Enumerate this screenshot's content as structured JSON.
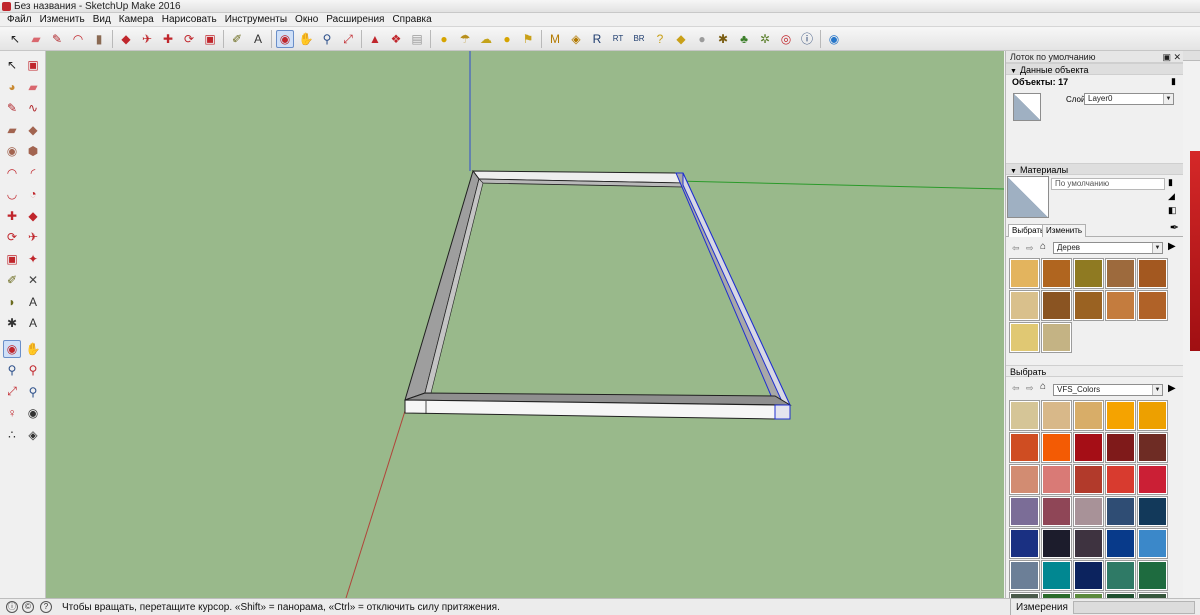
{
  "window": {
    "title": "Без названия - SketchUp Make 2016"
  },
  "menu": [
    "Файл",
    "Изменить",
    "Вид",
    "Камера",
    "Нарисовать",
    "Инструменты",
    "Окно",
    "Расширения",
    "Справка"
  ],
  "toolbar": {
    "tools": [
      {
        "name": "select-tool",
        "icon": "arrow-icon",
        "glyph": "↖",
        "color": "#222222",
        "active": false
      },
      {
        "name": "eraser-tool",
        "icon": "eraser-icon",
        "glyph": "▰",
        "color": "#d9676e",
        "active": false
      },
      {
        "name": "line-tool",
        "icon": "pencil-icon",
        "glyph": "✎",
        "color": "#b0272c",
        "active": false
      },
      {
        "name": "arc-tool",
        "icon": "arc-icon",
        "glyph": "◠",
        "color": "#c0262c",
        "active": false
      },
      {
        "name": "shape-tool",
        "icon": "rectangle-icon",
        "glyph": "▮",
        "color": "#8a6a53",
        "active": false
      },
      {
        "name": "push-pull-tool",
        "icon": "push-pull-icon",
        "glyph": "◆",
        "color": "#c0262c",
        "active": false
      },
      {
        "name": "follow-me-tool",
        "icon": "follow-me-icon",
        "glyph": "✈",
        "color": "#c0262c",
        "active": false
      },
      {
        "name": "move-tool",
        "icon": "move-icon",
        "glyph": "✚",
        "color": "#c0262c",
        "active": false
      },
      {
        "name": "rotate-tool",
        "icon": "rotate-icon",
        "glyph": "⟳",
        "color": "#c0262c",
        "active": false
      },
      {
        "name": "scale-tool",
        "icon": "scale-icon",
        "glyph": "▣",
        "color": "#c0262c",
        "active": false
      },
      {
        "name": "tape-measure-tool",
        "icon": "tape-measure-icon",
        "glyph": "✐",
        "color": "#6b6b1e",
        "active": false
      },
      {
        "name": "text-tool",
        "icon": "text-icon",
        "glyph": "A",
        "color": "#333333",
        "active": false
      },
      {
        "name": "orbit-tool",
        "icon": "orbit-icon",
        "glyph": "◉",
        "color": "#c0262c",
        "active": true
      },
      {
        "name": "pan-tool",
        "icon": "hand-icon",
        "glyph": "✋",
        "color": "#c98a32",
        "active": false
      },
      {
        "name": "zoom-tool",
        "icon": "magnifier-icon",
        "glyph": "⚲",
        "color": "#2c4f8a",
        "active": false
      },
      {
        "name": "zoom-extents-tool",
        "icon": "zoom-extents-icon",
        "glyph": "⤢",
        "color": "#c0262c",
        "active": false
      },
      {
        "name": "warehouse-button",
        "icon": "warehouse-icon",
        "glyph": "▲",
        "color": "#c0262c",
        "active": false
      },
      {
        "name": "components-button",
        "icon": "components-icon",
        "glyph": "❖",
        "color": "#c0262c",
        "active": false
      },
      {
        "name": "extensions-button",
        "icon": "extension-icon",
        "glyph": "▤",
        "color": "#999999",
        "active": false
      },
      {
        "name": "sun-button",
        "icon": "sun-icon",
        "glyph": "●",
        "color": "#d6a400",
        "active": false
      },
      {
        "name": "umbrella-button",
        "icon": "umbrella-icon",
        "glyph": "☂",
        "color": "#b88f1c",
        "active": false
      },
      {
        "name": "cloud-button",
        "icon": "cloud-icon",
        "glyph": "☁",
        "color": "#c4a31a",
        "active": false
      },
      {
        "name": "location-button",
        "icon": "pin-icon",
        "glyph": "●",
        "color": "#d6a400",
        "active": false
      },
      {
        "name": "flag-button",
        "icon": "flag-icon",
        "glyph": "⚑",
        "color": "#c9a018",
        "active": false
      },
      {
        "name": "m-button",
        "icon": "m-badge-icon",
        "glyph": "M",
        "color": "#b37a00",
        "active": false
      },
      {
        "name": "tag-button",
        "icon": "tag-icon",
        "glyph": "◈",
        "color": "#b37a00",
        "active": false
      },
      {
        "name": "r-button",
        "icon": "r-badge-icon",
        "glyph": "R",
        "color": "#1e3c6e",
        "active": false
      },
      {
        "name": "rt-button",
        "icon": "rt-badge-icon",
        "glyph": "RT",
        "color": "#1e3c6e",
        "active": false
      },
      {
        "name": "br-button",
        "icon": "br-badge-icon",
        "glyph": "BR",
        "color": "#1e3c6e",
        "active": false
      },
      {
        "name": "help-badge-button",
        "icon": "question-icon",
        "glyph": "?",
        "color": "#c9a018",
        "active": false
      },
      {
        "name": "diamond-button",
        "icon": "diamond-icon",
        "glyph": "◆",
        "color": "#c9a018",
        "active": false
      },
      {
        "name": "ball-button",
        "icon": "sphere-icon",
        "glyph": "●",
        "color": "#9b9b9b",
        "active": false
      },
      {
        "name": "bug-button",
        "icon": "bug-icon",
        "glyph": "✱",
        "color": "#7a5d12",
        "active": false
      },
      {
        "name": "tree-button",
        "icon": "tree-icon",
        "glyph": "♣",
        "color": "#3d7f2b",
        "active": false
      },
      {
        "name": "gear-button",
        "icon": "gear-icon",
        "glyph": "✲",
        "color": "#5b7f2b",
        "active": false
      },
      {
        "name": "target-button",
        "icon": "target-icon",
        "glyph": "◎",
        "color": "#c0262c",
        "active": false
      },
      {
        "name": "info-button",
        "icon": "info-icon",
        "glyph": "ⓘ",
        "color": "#1e3c6e",
        "active": false
      },
      {
        "name": "settings-button",
        "icon": "settings-icon",
        "glyph": "◉",
        "color": "#2676c9",
        "active": false
      }
    ]
  },
  "left_tools": [
    {
      "name": "select-tool",
      "icon": "arrow-icon",
      "glyph": "↖",
      "color": "#222222"
    },
    {
      "name": "make-component-tool",
      "icon": "component-icon",
      "glyph": "▣",
      "color": "#c0262c"
    },
    {
      "name": "paint-bucket-tool",
      "icon": "paint-bucket-icon",
      "glyph": "◕",
      "color": "#c98a32"
    },
    {
      "name": "eraser-tool",
      "icon": "eraser-icon",
      "glyph": "▰",
      "color": "#d9676e"
    },
    {
      "name": "line-tool",
      "icon": "pencil-icon",
      "glyph": "✎",
      "color": "#b0272c"
    },
    {
      "name": "freehand-tool",
      "icon": "freehand-icon",
      "glyph": "∿",
      "color": "#b0272c"
    },
    {
      "name": "rectangle-tool",
      "icon": "rectangle-icon",
      "glyph": "▰",
      "color": "#a26450"
    },
    {
      "name": "rotated-rectangle-tool",
      "icon": "rotated-rectangle-icon",
      "glyph": "◆",
      "color": "#a26450"
    },
    {
      "name": "circle-tool",
      "icon": "circle-icon",
      "glyph": "◉",
      "color": "#a26450"
    },
    {
      "name": "polygon-tool",
      "icon": "polygon-icon",
      "glyph": "⬢",
      "color": "#a26450"
    },
    {
      "name": "arc-tool",
      "icon": "arc-icon",
      "glyph": "◠",
      "color": "#c0262c"
    },
    {
      "name": "two-point-arc-tool",
      "icon": "two-point-arc-icon",
      "glyph": "◜",
      "color": "#c0262c"
    },
    {
      "name": "three-point-arc-tool",
      "icon": "three-point-arc-icon",
      "glyph": "◡",
      "color": "#c0262c"
    },
    {
      "name": "pie-tool",
      "icon": "pie-icon",
      "glyph": "◔",
      "color": "#c0262c"
    },
    {
      "name": "move-tool",
      "icon": "move-icon",
      "glyph": "✚",
      "color": "#c0262c"
    },
    {
      "name": "push-pull-tool",
      "icon": "push-pull-icon",
      "glyph": "◆",
      "color": "#c0262c"
    },
    {
      "name": "rotate-tool",
      "icon": "rotate-icon",
      "glyph": "⟳",
      "color": "#c0262c"
    },
    {
      "name": "follow-me-tool",
      "icon": "follow-me-icon",
      "glyph": "✈",
      "color": "#c0262c"
    },
    {
      "name": "scale-tool",
      "icon": "scale-icon",
      "glyph": "▣",
      "color": "#c0262c"
    },
    {
      "name": "offset-tool",
      "icon": "offset-icon",
      "glyph": "✦",
      "color": "#c0262c"
    },
    {
      "name": "tape-measure-tool",
      "icon": "tape-measure-icon",
      "glyph": "✐",
      "color": "#6b6b1e"
    },
    {
      "name": "dimension-tool",
      "icon": "dimension-icon",
      "glyph": "✕",
      "color": "#444444"
    },
    {
      "name": "protractor-tool",
      "icon": "protractor-icon",
      "glyph": "◗",
      "color": "#6b6b1e"
    },
    {
      "name": "text-tool",
      "icon": "text-icon",
      "glyph": "A",
      "color": "#333333"
    },
    {
      "name": "axes-tool",
      "icon": "axes-icon",
      "glyph": "✱",
      "color": "#333333"
    },
    {
      "name": "3d-text-tool",
      "icon": "3d-text-icon",
      "glyph": "A",
      "color": "#333333"
    },
    {
      "name": "orbit-tool",
      "icon": "orbit-icon",
      "glyph": "◉",
      "color": "#c0262c"
    },
    {
      "name": "pan-tool",
      "icon": "hand-icon",
      "glyph": "✋",
      "color": "#c98a32"
    },
    {
      "name": "zoom-tool",
      "icon": "magnifier-icon",
      "glyph": "⚲",
      "color": "#2c4f8a"
    },
    {
      "name": "zoom-window-tool",
      "icon": "zoom-window-icon",
      "glyph": "⚲",
      "color": "#c0262c"
    },
    {
      "name": "zoom-extents-tool",
      "icon": "zoom-extents-icon",
      "glyph": "⤢",
      "color": "#c0262c"
    },
    {
      "name": "previous-view-tool",
      "icon": "previous-view-icon",
      "glyph": "⚲",
      "color": "#2c4f8a"
    },
    {
      "name": "position-camera-tool",
      "icon": "position-camera-icon",
      "glyph": "♀",
      "color": "#c0262c"
    },
    {
      "name": "look-around-tool",
      "icon": "eye-icon",
      "glyph": "◉",
      "color": "#333333"
    },
    {
      "name": "walk-tool",
      "icon": "footprints-icon",
      "glyph": "∴",
      "color": "#333333"
    },
    {
      "name": "section-plane-tool",
      "icon": "section-plane-icon",
      "glyph": "◈",
      "color": "#333333"
    }
  ],
  "tray": {
    "title": "Лоток по умолчанию",
    "entity_info": {
      "header": "Данные объекта",
      "objects_label": "Объекты: 17",
      "layer_label": "Слой:",
      "layer_value": "Layer0"
    },
    "materials": {
      "header": "Материалы",
      "current_name": "По умолчанию",
      "tab_select": "Выбрать",
      "tab_edit": "Изменить",
      "library": "Дерев",
      "wood_swatches": [
        "#e3b45e",
        "#b0651f",
        "#8f7a22",
        "#9d6a3d",
        "#a35820",
        "#d9c08c",
        "#8a5422",
        "#9a6222",
        "#c47c3e",
        "#b06228",
        "#e0c873",
        "#c4b384"
      ],
      "second_header": "Выбрать",
      "second_library": "VFS_Colors",
      "color_swatches": [
        "#d5c597",
        "#d8b889",
        "#d8ad68",
        "#f5a300",
        "#eda000",
        "#cf4d22",
        "#f35b04",
        "#a50e16",
        "#7f1a1a",
        "#6e2c24",
        "#d28c72",
        "#d97a76",
        "#b23a2b",
        "#d83b2f",
        "#cb1f35",
        "#7b6d97",
        "#8f4657",
        "#a89298",
        "#2f4d74",
        "#12395a",
        "#1a3082",
        "#1c1c2c",
        "#3e3340",
        "#083a8a",
        "#3b88c9",
        "#6c7f97",
        "#018791",
        "#0c235e",
        "#2f7a66",
        "#1e6b3f",
        "#4a5a4a",
        "#2a6b2a",
        "#5b8a3c",
        "#1f4f2f",
        "#36563c"
      ]
    }
  },
  "status": {
    "hint": "Чтобы вращать, перетащите курсор. «Shift» = панорама, «Ctrl» = отключить силу притяжения.",
    "measure_label": "Измерения"
  }
}
